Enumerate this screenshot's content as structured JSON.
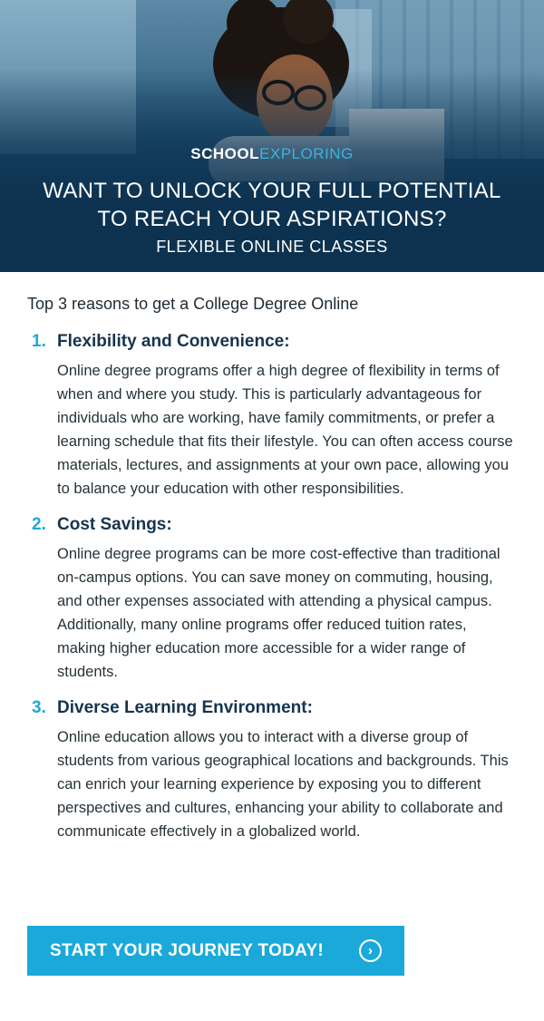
{
  "hero": {
    "logo": {
      "word1": "SCHOOL",
      "word2": "EXPLORING",
      "magnifier_icon": "magnifier-icon"
    },
    "headline_line1": "WANT TO UNLOCK YOUR FULL POTENTIAL",
    "headline_line2": "TO REACH YOUR ASPIRATIONS?",
    "subheadline": "FLEXIBLE ONLINE CLASSES"
  },
  "intro": "Top 3 reasons to get a College Degree Online",
  "reasons": [
    {
      "number": "1.",
      "title": "Flexibility and Convenience:",
      "text": "Online degree programs offer a high degree of flexibility in terms of when and where you study. This is particularly advantageous for individuals who are working, have family commitments, or prefer a learning schedule that fits their lifestyle. You can often access course materials, lectures, and assignments at your own pace, allowing you to balance your education with other responsibilities."
    },
    {
      "number": "2.",
      "title": "Cost Savings:",
      "text": "Online degree programs can be more cost-effective than traditional on-campus options. You can save money on commuting, housing, and other expenses associated with attending a physical campus. Additionally, many online programs offer reduced tuition rates, making higher education more accessible for a wider range of students."
    },
    {
      "number": "3.",
      "title": "Diverse Learning Environment:",
      "text": "Online education allows you to interact with a diverse group of students from various geographical locations and backgrounds. This can enrich your learning experience by exposing you to different perspectives and cultures, enhancing your ability to collaborate and communicate effectively in a globalized world."
    }
  ],
  "cta": {
    "label": "START YOUR JOURNEY TODAY!",
    "icon": "chevron-right-circle-icon"
  },
  "colors": {
    "accent": "#1ba9d9",
    "navy": "#16344f",
    "hero_dark": "#0f3655"
  }
}
